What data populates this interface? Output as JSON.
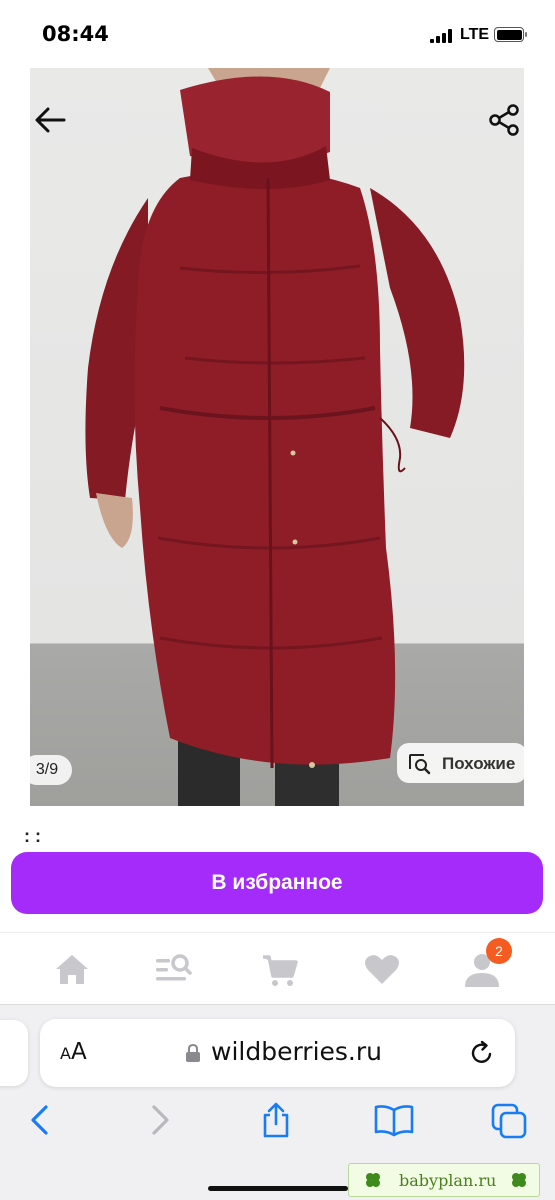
{
  "status_bar": {
    "time": "08:44",
    "network": "LTE"
  },
  "gallery": {
    "counter": "3/9",
    "similar_label": "Похожие"
  },
  "product": {
    "title_stub": ": :"
  },
  "cta": {
    "label": "В избранное"
  },
  "tabbar": {
    "items": [
      "home-icon",
      "catalog-search-icon",
      "cart-icon",
      "favorites-heart-icon",
      "profile-icon"
    ],
    "profile_badge": "2"
  },
  "browser": {
    "text_size_label": "AA",
    "url": "wildberries.ru"
  },
  "watermark": {
    "text": "babyplan.ru"
  },
  "colors": {
    "accent": "#a52bfa",
    "badge": "#f55c22",
    "coat": "#8f1d27",
    "icon_gray": "#c7c7cc",
    "safari_blue": "#1a7cf5"
  }
}
